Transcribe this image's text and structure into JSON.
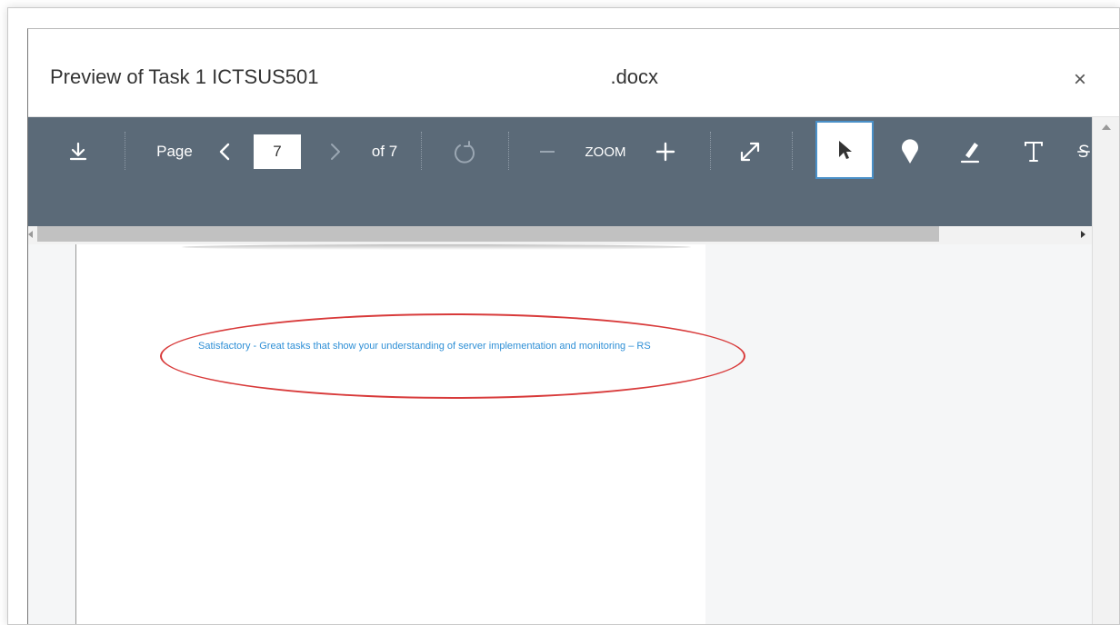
{
  "dialog": {
    "title": "Preview of Task 1 ICTSUS501",
    "file_suffix": ".docx",
    "close_label": "×"
  },
  "toolbar": {
    "page_label": "Page",
    "current_page": "7",
    "of_pages": "of 7",
    "zoom_label": "ZOOM",
    "icons": [
      "download-icon",
      "chevron-left-icon",
      "chevron-right-icon",
      "rotate-icon",
      "zoom-out-icon",
      "zoom-in-icon",
      "fullscreen-icon",
      "pointer-icon",
      "pin-icon",
      "highlighter-icon",
      "text-icon",
      "strikethrough-icon"
    ]
  },
  "document": {
    "comment_text": "Satisfactory - Great tasks that show your understanding of server implementation and monitoring – RS"
  },
  "colors": {
    "toolbar": "#5b6a78",
    "comment": "#2e8fd6",
    "annotation": "#d83a3a",
    "selected_tool_border": "#4a90c8"
  }
}
